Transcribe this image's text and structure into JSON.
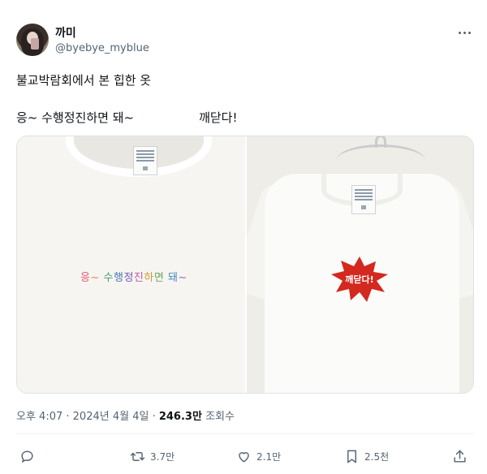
{
  "user": {
    "display_name": "까미",
    "handle": "@byebye_myblue"
  },
  "tweet": {
    "line1": "불교박람회에서 본 힙한 옷",
    "line2_left": "응~ 수행정진하면 돼~",
    "line2_right": "깨닫다!"
  },
  "media": {
    "left_print_chars": [
      "응",
      "~",
      " ",
      "수",
      "행",
      "정",
      "진",
      "하",
      "면",
      " ",
      "돼",
      "~"
    ],
    "left_print_colors": [
      "#e05a7a",
      "#e08a4a",
      "#000000",
      "#4a9a6a",
      "#4a7ab0",
      "#7a5ab0",
      "#c05a9a",
      "#d09a3a",
      "#6aaa5a",
      "#000000",
      "#4a8ac0",
      "#9a6ab0"
    ],
    "right_print": "깨닫다!",
    "burst_color": "#d3291f",
    "tag_size": "L"
  },
  "meta": {
    "time": "오후 4:07",
    "date": "2024년 4월 4일",
    "views_count": "246.3만",
    "views_label": "조회수"
  },
  "actions": {
    "reply_count": "",
    "retweet_count": "3.7만",
    "like_count": "2.1만",
    "bookmark_count": "2.5천"
  },
  "icons": [
    "more-icon",
    "reply-icon",
    "retweet-icon",
    "like-icon",
    "bookmark-icon",
    "share-icon"
  ]
}
